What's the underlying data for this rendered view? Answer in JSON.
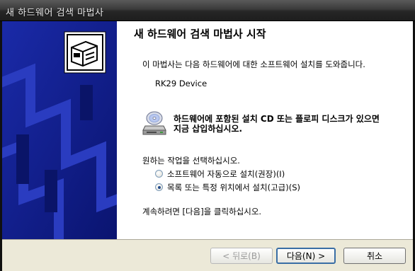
{
  "window": {
    "title": "새 하드웨어 검색 마법사"
  },
  "wizard": {
    "heading": "새 하드웨어 검색 마법사 시작",
    "intro": "이 마법사는 다음 하드웨어에 대한 소프트웨어 설치를 도와줍니다.",
    "device_name": "RK29 Device",
    "cd_prompt": "하드웨어에 포함된 설치 CD 또는 플로피 디스크가 있으면 지금 삽입하십시오.",
    "choose_prompt": "원하는 작업을 선택하십시오.",
    "options": [
      {
        "label": "소프트웨어 자동으로 설치(권장)(I)",
        "selected": false
      },
      {
        "label": "목록 또는 특정 위치에서 설치(고급)(S)",
        "selected": true
      }
    ],
    "continue_text": "계속하려면 [다음]을 클릭하십시오."
  },
  "buttons": {
    "back": "< 뒤로(B)",
    "next": "다음(N) >",
    "cancel": "취소"
  },
  "icons": {
    "sidebar": "hardware-box-icon",
    "cd": "cd-drive-icon"
  }
}
